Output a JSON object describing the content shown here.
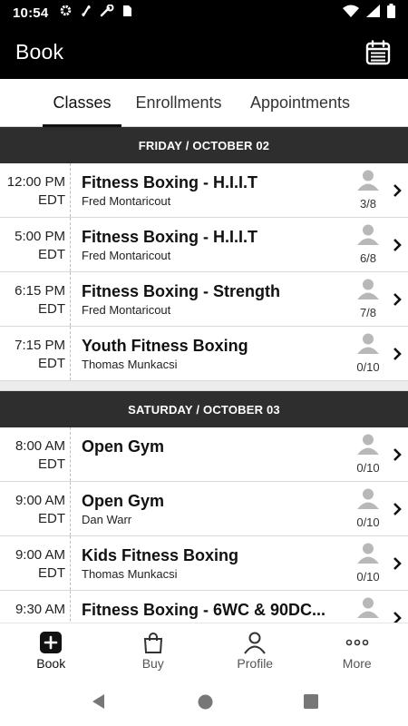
{
  "status_bar": {
    "time": "10:54",
    "icons": [
      "gear-icon",
      "link-icon",
      "wrench-icon",
      "sim-card-icon",
      "wifi-icon",
      "signal-icon",
      "battery-icon"
    ]
  },
  "app_bar": {
    "title": "Book",
    "calendar_icon": "calendar-icon"
  },
  "tabs": [
    {
      "label": "Classes",
      "active": true
    },
    {
      "label": "Enrollments",
      "active": false
    },
    {
      "label": "Appointments",
      "active": false
    }
  ],
  "days": [
    {
      "header": "FRIDAY / OCTOBER 02",
      "classes": [
        {
          "time": "12:00 PM",
          "tz": "EDT",
          "name": "Fitness Boxing - H.I.I.T",
          "instructor": "Fred Montaricout",
          "capacity": "3/8"
        },
        {
          "time": "5:00 PM",
          "tz": "EDT",
          "name": "Fitness Boxing - H.I.I.T",
          "instructor": "Fred Montaricout",
          "capacity": "6/8"
        },
        {
          "time": "6:15 PM",
          "tz": "EDT",
          "name": "Fitness Boxing - Strength",
          "instructor": "Fred Montaricout",
          "capacity": "7/8"
        },
        {
          "time": "7:15 PM",
          "tz": "EDT",
          "name": "Youth Fitness Boxing",
          "instructor": "Thomas Munkacsi",
          "capacity": "0/10"
        }
      ]
    },
    {
      "header": "SATURDAY / OCTOBER 03",
      "classes": [
        {
          "time": "8:00 AM",
          "tz": "EDT",
          "name": "Open Gym",
          "instructor": "",
          "capacity": "0/10"
        },
        {
          "time": "9:00 AM",
          "tz": "EDT",
          "name": "Open Gym",
          "instructor": "Dan Warr",
          "capacity": "0/10"
        },
        {
          "time": "9:00 AM",
          "tz": "EDT",
          "name": "Kids Fitness Boxing",
          "instructor": "Thomas Munkacsi",
          "capacity": "0/10"
        },
        {
          "time": "9:30 AM",
          "tz": "",
          "name": "Fitness Boxing - 6WC & 90DC...",
          "instructor": "",
          "capacity": ""
        }
      ]
    }
  ],
  "bottom_nav": [
    {
      "label": "Book",
      "icon": "plus-square-icon",
      "active": true
    },
    {
      "label": "Buy",
      "icon": "shopping-bag-icon",
      "active": false
    },
    {
      "label": "Profile",
      "icon": "person-icon",
      "active": false
    },
    {
      "label": "More",
      "icon": "more-dots-icon",
      "active": false
    }
  ],
  "system_nav": [
    "back-icon",
    "home-icon",
    "recents-icon"
  ],
  "colors": {
    "app_bar_bg": "#000000",
    "day_header_bg": "#2e2e2e",
    "capacity_icon": "#b8b8b8"
  }
}
